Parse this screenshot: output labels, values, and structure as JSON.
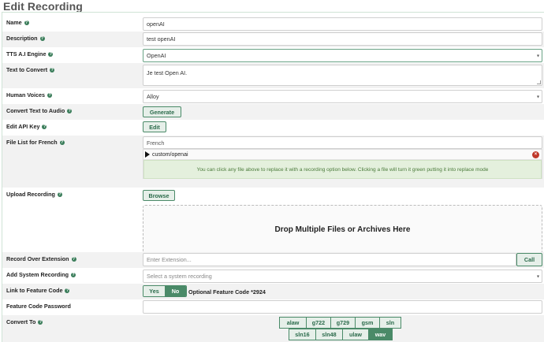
{
  "page": {
    "title": "Edit Recording"
  },
  "fields": {
    "name": {
      "label": "Name",
      "value": "openAI"
    },
    "description": {
      "label": "Description",
      "value": "test openAI"
    },
    "tts_engine": {
      "label": "TTS A.I Engine",
      "value": "OpenAI"
    },
    "text_to_convert": {
      "label": "Text to Convert",
      "value": "Je test Open AI."
    },
    "human_voices": {
      "label": "Human Voices",
      "value": "Alloy"
    },
    "convert_text": {
      "label": "Convert Text to Audio",
      "button": "Generate"
    },
    "edit_api_key": {
      "label": "Edit API Key",
      "button": "Edit"
    },
    "file_list": {
      "label": "File List for French",
      "language": "French",
      "file": "custom/openai",
      "info": "You can click any file above to replace it with a recording option below. Clicking a file will turn it green putting it into replace mode"
    },
    "upload": {
      "label": "Upload Recording",
      "button": "Browse",
      "dropzone": "Drop Multiple Files or Archives Here"
    },
    "record_over_extension": {
      "label": "Record Over Extension",
      "placeholder": "Enter Extension...",
      "button": "Call"
    },
    "add_system_recording": {
      "label": "Add System Recording",
      "placeholder": "Select a system recording"
    },
    "link_feature_code": {
      "label": "Link to Feature Code",
      "yes": "Yes",
      "no": "No",
      "selected": "No",
      "note": "Optional Feature Code *2924"
    },
    "feature_code_password": {
      "label": "Feature Code Password",
      "value": ""
    },
    "convert_to": {
      "label": "Convert To",
      "row1": [
        "alaw",
        "g722",
        "g729",
        "gsm",
        "sln"
      ],
      "row2": [
        "sln16",
        "sln48",
        "ulaw",
        "wav"
      ],
      "selected": [
        "wav"
      ]
    }
  },
  "icons": {
    "help": "help-icon",
    "play": "play-icon",
    "remove": "remove-icon",
    "caret": "chevron-down-icon"
  },
  "colors": {
    "accent": "#4a8a68",
    "button_bg": "#e6efe9",
    "info_bg": "#e4f0dd",
    "remove": "#c0392b"
  }
}
